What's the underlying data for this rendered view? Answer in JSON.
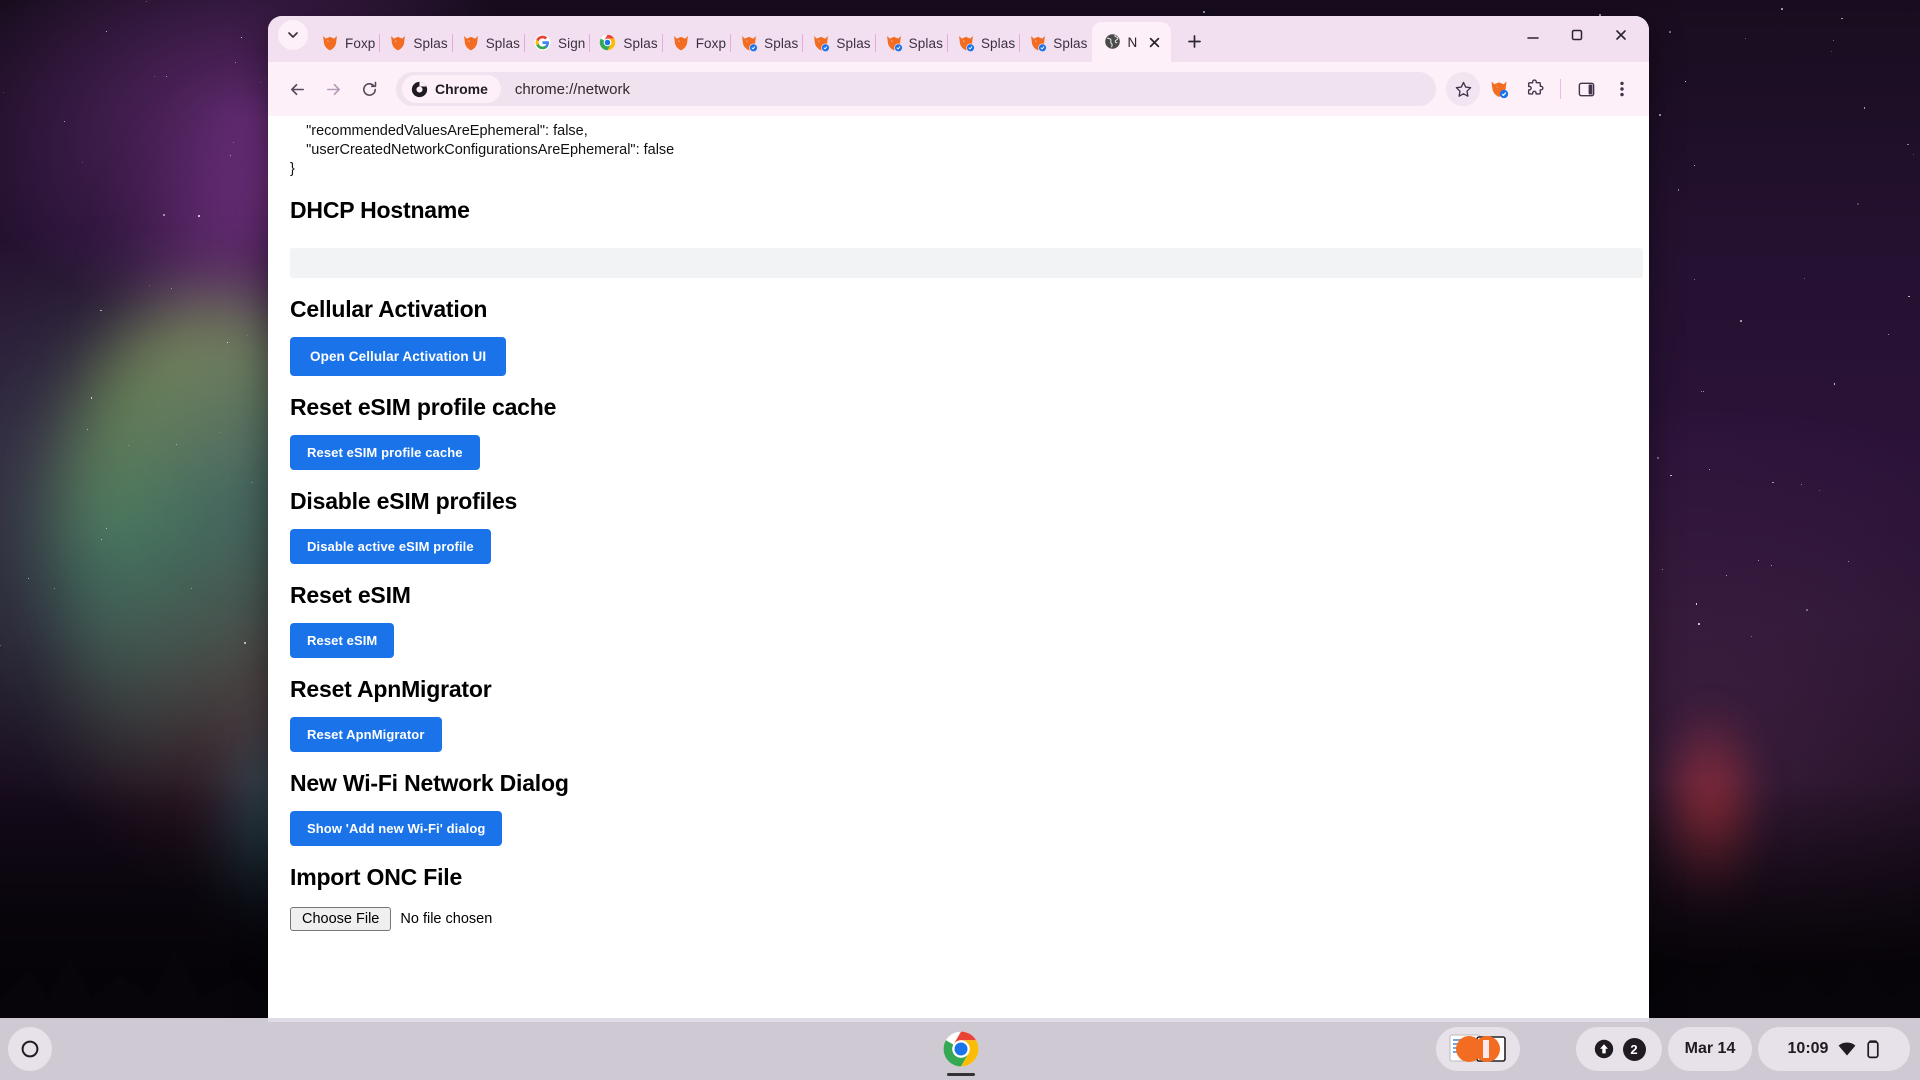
{
  "window": {
    "tablist_icon": "chevron-down-icon",
    "newtab_icon": "plus-icon",
    "minimize_icon": "minimize-icon",
    "maximize_icon": "maximize-icon",
    "close_icon": "close-icon"
  },
  "tabs": [
    {
      "label": "Foxp",
      "icon": "foxyproxy-icon",
      "badge": false,
      "active": false
    },
    {
      "label": "Splas",
      "icon": "foxyproxy-icon",
      "badge": false,
      "active": false
    },
    {
      "label": "Splas",
      "icon": "foxyproxy-icon",
      "badge": false,
      "active": false
    },
    {
      "label": "Sign",
      "icon": "google-icon",
      "badge": false,
      "active": false
    },
    {
      "label": "Splas",
      "icon": "chrome-icon",
      "badge": false,
      "active": false
    },
    {
      "label": "Foxp",
      "icon": "foxyproxy-icon",
      "badge": false,
      "active": false
    },
    {
      "label": "Splas",
      "icon": "foxyproxy-badge-icon",
      "badge": true,
      "active": false
    },
    {
      "label": "Splas",
      "icon": "foxyproxy-badge-icon",
      "badge": true,
      "active": false
    },
    {
      "label": "Splas",
      "icon": "foxyproxy-badge-icon",
      "badge": true,
      "active": false
    },
    {
      "label": "Splas",
      "icon": "foxyproxy-badge-icon",
      "badge": true,
      "active": false
    },
    {
      "label": "Splas",
      "icon": "foxyproxy-badge-icon",
      "badge": true,
      "active": false
    },
    {
      "label": "N",
      "icon": "globe-icon",
      "badge": false,
      "active": true
    }
  ],
  "toolbar": {
    "back_icon": "back-arrow-icon",
    "forward_icon": "forward-arrow-icon",
    "reload_icon": "reload-icon",
    "chrome_chip_label": "Chrome",
    "chrome_chip_icon": "chrome-mono-icon",
    "url": "chrome://network",
    "bookmark_icon": "star-icon",
    "extension_foxyproxy_icon": "foxyproxy-badge-icon",
    "extensions_icon": "puzzle-icon",
    "side_panel_icon": "side-panel-icon",
    "menu_icon": "three-dot-menu-icon"
  },
  "page": {
    "json_lines": [
      "    \"recommendedValuesAreEphemeral\": false,",
      "    \"userCreatedNetworkConfigurationsAreEphemeral\": false",
      "}"
    ],
    "sections": [
      {
        "heading": "DHCP Hostname",
        "control": "input",
        "value": "",
        "placeholder": ""
      },
      {
        "heading": "Cellular Activation",
        "control": "button",
        "button": "Open Cellular Activation UI"
      },
      {
        "heading": "Reset eSIM profile cache",
        "control": "button",
        "button": "Reset eSIM profile cache"
      },
      {
        "heading": "Disable eSIM profiles",
        "control": "button",
        "button": "Disable active eSIM profile"
      },
      {
        "heading": "Reset eSIM",
        "control": "button",
        "button": "Reset eSIM"
      },
      {
        "heading": "Reset ApnMigrator",
        "control": "button",
        "button": "Reset ApnMigrator"
      },
      {
        "heading": "New Wi-Fi Network Dialog",
        "control": "button",
        "button": "Show 'Add new Wi-Fi' dialog"
      },
      {
        "heading": "Import ONC File",
        "control": "file",
        "choose_label": "Choose File",
        "file_status": "No file chosen"
      }
    ]
  },
  "shelf": {
    "launcher_icon": "launcher-circle-icon",
    "chrome_icon": "chrome-icon",
    "capture_icon": "window-capture-icon",
    "upload_icon": "upload-arrow-icon",
    "notification_count": "2",
    "date": "Mar 14",
    "time": "10:09",
    "wifi_icon": "wifi-icon",
    "battery_icon": "battery-icon"
  },
  "colors": {
    "accent_blue": "#1a73e8",
    "tabstrip": "#f2dff0",
    "toolbar": "#fdf0f8",
    "omnibox": "#f0e2ee"
  }
}
